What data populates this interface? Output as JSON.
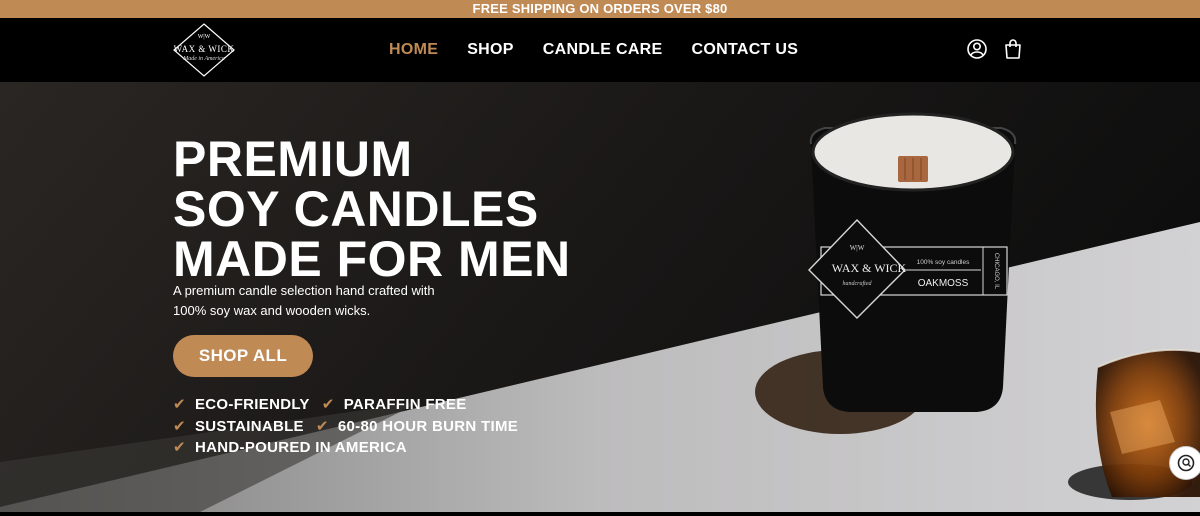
{
  "announcement": "FREE SHIPPING ON ORDERS OVER $80",
  "logo": {
    "top": "W|W",
    "name": "WAX & WICK",
    "tagline": "Made in America"
  },
  "nav": {
    "items": [
      "HOME",
      "SHOP",
      "CANDLE CARE",
      "CONTACT US"
    ],
    "active": "HOME"
  },
  "header_icons": [
    "account-icon",
    "cart-icon"
  ],
  "hero": {
    "title_lines": [
      "PREMIUM",
      "SOY CANDLES",
      "MADE FOR MEN"
    ],
    "subtitle_lines": [
      "A premium candle selection hand crafted with",
      "100% soy wax and wooden wicks."
    ],
    "cta": "SHOP ALL",
    "features": [
      [
        "ECO-FRIENDLY",
        "PARAFFIN FREE"
      ],
      [
        "SUSTAINABLE",
        "60-80 HOUR BURN TIME"
      ],
      [
        "HAND-POURED IN AMERICA"
      ]
    ]
  },
  "product_label": {
    "brand_top": "W|W",
    "brand": "WAX & WICK",
    "brand_script": "handcrafted",
    "line1": "100% soy candles",
    "scent": "OAKMOSS",
    "side": "CHICAGO, IL"
  },
  "colors": {
    "accent": "#c08a55",
    "header_bg": "#000000",
    "text": "#ffffff"
  }
}
